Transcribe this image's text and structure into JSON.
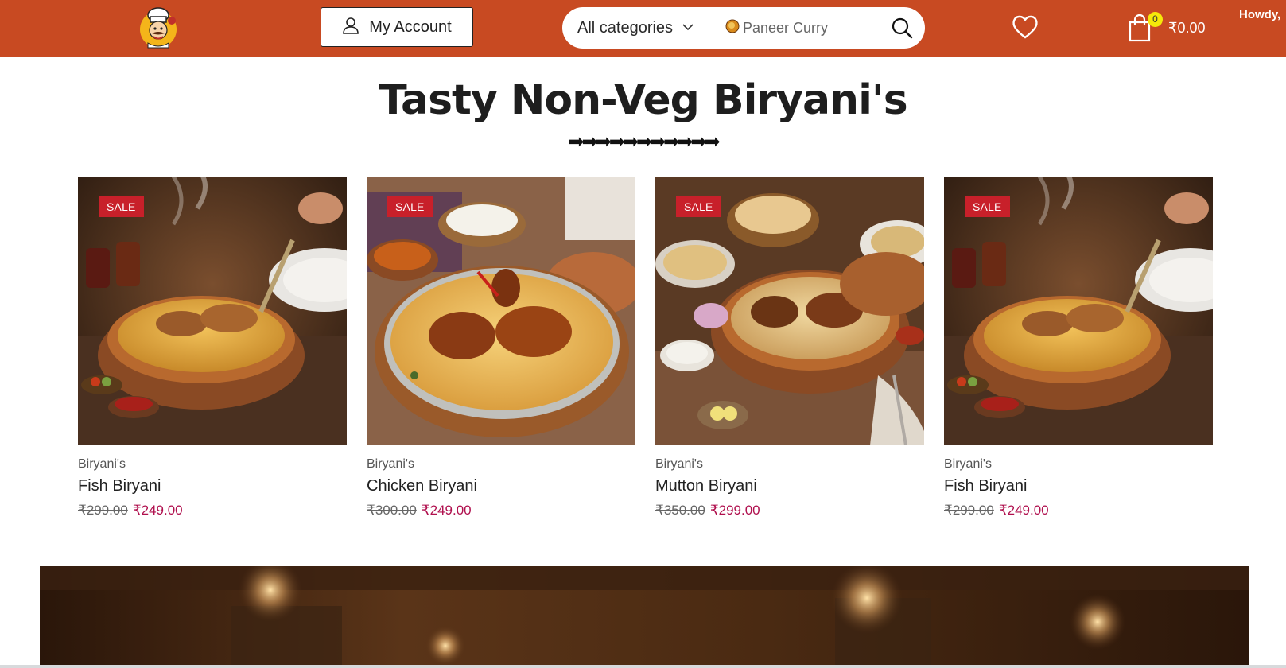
{
  "header": {
    "logo_icon": "chef-logo-icon",
    "account_label": "My Account",
    "category_selected": "All categories",
    "search_placeholder": "Paneer Curry",
    "cart_count": "0",
    "cart_total": "₹0.00",
    "greeting": "Howdy,",
    "bg_color": "#c84a22"
  },
  "section": {
    "title": "Tasty Non-Veg Biryani's",
    "arrows": "➡➡➡➡➡➡➡➡➡➡➡"
  },
  "products": [
    {
      "sale": "SALE",
      "category": "Biryani's",
      "name": "Fish Biryani",
      "old_price": "₹299.00",
      "new_price": "₹249.00"
    },
    {
      "sale": "SALE",
      "category": "Biryani's",
      "name": "Chicken Biryani",
      "old_price": "₹300.00",
      "new_price": "₹249.00"
    },
    {
      "sale": "SALE",
      "category": "Biryani's",
      "name": "Mutton Biryani",
      "old_price": "₹350.00",
      "new_price": "₹299.00"
    },
    {
      "sale": "SALE",
      "category": "Biryani's",
      "name": "Fish Biryani",
      "old_price": "₹299.00",
      "new_price": "₹249.00"
    }
  ],
  "colors": {
    "sale_badge": "#c8202a",
    "sale_price": "#b0104e",
    "cart_badge": "#f5e90a"
  }
}
